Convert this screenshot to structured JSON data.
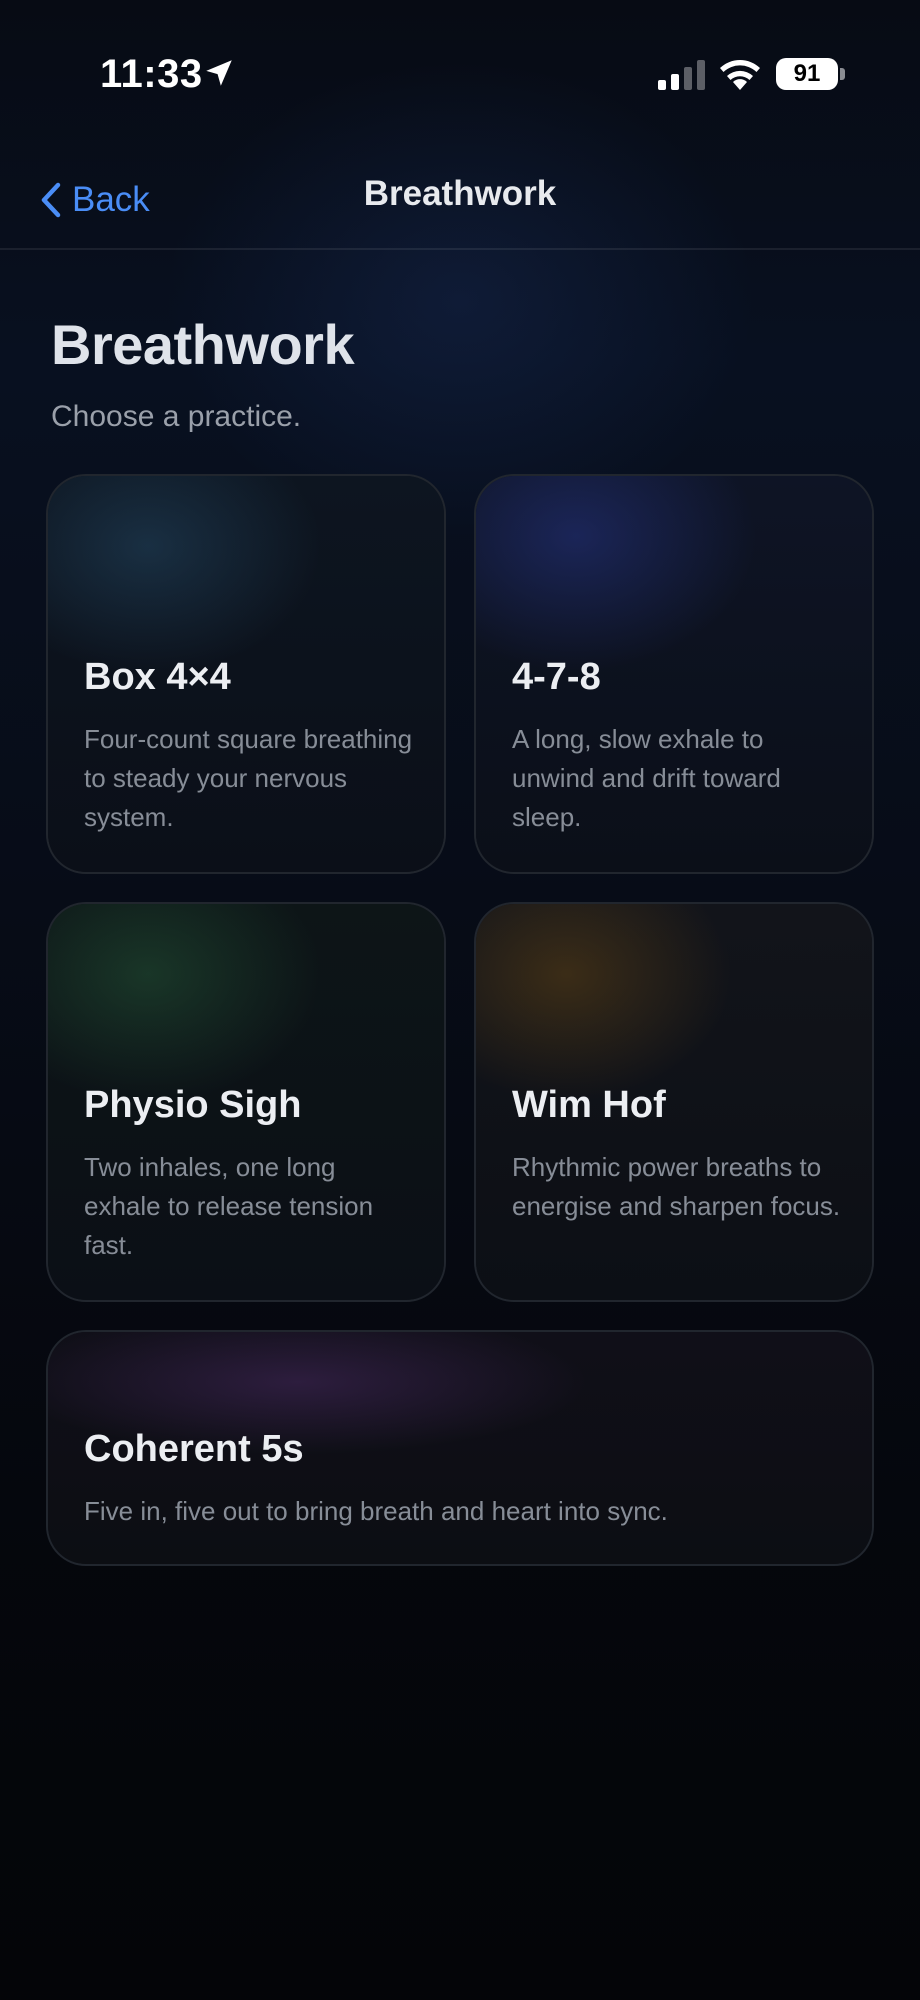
{
  "status_bar": {
    "time": "11:33",
    "battery": "91",
    "icons": [
      "location-arrow-icon",
      "cellular-signal-icon",
      "wifi-icon",
      "battery-icon"
    ]
  },
  "nav": {
    "back_label": "Back",
    "title": "Breathwork",
    "accent_color": "#4a8df6"
  },
  "header": {
    "title": "Breathwork",
    "subtitle": "Choose a practice."
  },
  "practices": [
    {
      "title": "Box 4×4",
      "description": "Four-count square breathing to steady your nervous system.",
      "glow": "#28506e"
    },
    {
      "title": "4-7-8",
      "description": "A long, slow exhale to unwind and drift toward sleep.",
      "glow": "#28378c"
    },
    {
      "title": "Physio Sigh",
      "description": "Two inhales, one long exhale to release tension fast.",
      "glow": "#285f3c"
    },
    {
      "title": "Wim Hof",
      "description": "Rhythmic power breaths to energise and sharpen focus.",
      "glow": "#6e4b14"
    },
    {
      "title": "Coherent 5s",
      "description": "Five in, five out to bring breath and heart into sync.",
      "glow": "#5a3278"
    }
  ]
}
